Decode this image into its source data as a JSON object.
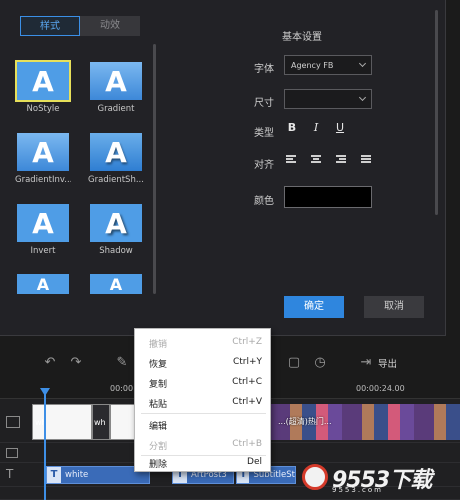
{
  "dialog": {
    "tabs": [
      {
        "label": "样式",
        "active": true
      },
      {
        "label": "动效",
        "active": false
      }
    ],
    "styles": [
      {
        "label": "NoStyle",
        "glyph": "A",
        "selected": true
      },
      {
        "label": "Gradient",
        "glyph": "A",
        "selected": false
      },
      {
        "label": "GradientInv...",
        "glyph": "A",
        "selected": false
      },
      {
        "label": "GradientSh...",
        "glyph": "A",
        "selected": false
      },
      {
        "label": "Invert",
        "glyph": "A",
        "selected": false
      },
      {
        "label": "Shadow",
        "glyph": "A",
        "selected": false
      }
    ],
    "settings_title": "基本设置",
    "font_label": "字体",
    "font_value": "Agency FB",
    "size_label": "尺寸",
    "size_value": "",
    "type_label": "类型",
    "type_buttons": [
      "B",
      "I",
      "U"
    ],
    "align_label": "对齐",
    "color_label": "颜色",
    "color_value": "#000000",
    "confirm_label": "确定",
    "cancel_label": "取消"
  },
  "toolbar": {
    "icons": [
      "undo-icon",
      "redo-icon",
      "edit-icon",
      "crop-icon",
      "timer-icon",
      "export-icon"
    ],
    "export_label": "导出"
  },
  "timeline": {
    "timecode_1": "00:00",
    "timecode_2": "00:00:24.00",
    "video_clips": [
      {
        "label": "wh"
      },
      {
        "label": "wh"
      }
    ],
    "film_caption": "...(超清)热门...",
    "text_clips": [
      {
        "label": "white"
      },
      {
        "label": "ArtPost3"
      },
      {
        "label": "SubtitleSt"
      }
    ]
  },
  "context_menu": {
    "items": [
      {
        "label": "撤销",
        "shortcut": "Ctrl+Z",
        "enabled": false
      },
      {
        "label": "恢复",
        "shortcut": "Ctrl+Y",
        "enabled": true
      },
      {
        "label": "复制",
        "shortcut": "Ctrl+C",
        "enabled": true
      },
      {
        "label": "粘贴",
        "shortcut": "Ctrl+V",
        "enabled": true
      },
      {
        "label": "编辑",
        "shortcut": "",
        "enabled": true
      },
      {
        "label": "分割",
        "shortcut": "Ctrl+B",
        "enabled": false
      },
      {
        "label": "删除",
        "shortcut": "Del",
        "enabled": true
      }
    ]
  },
  "watermark": {
    "text": "9553下载",
    "sub": "9553.com"
  },
  "colors": {
    "accent": "#2f86de",
    "selected_outline": "#e7e05a",
    "text_clip": "#3a6bb8"
  }
}
